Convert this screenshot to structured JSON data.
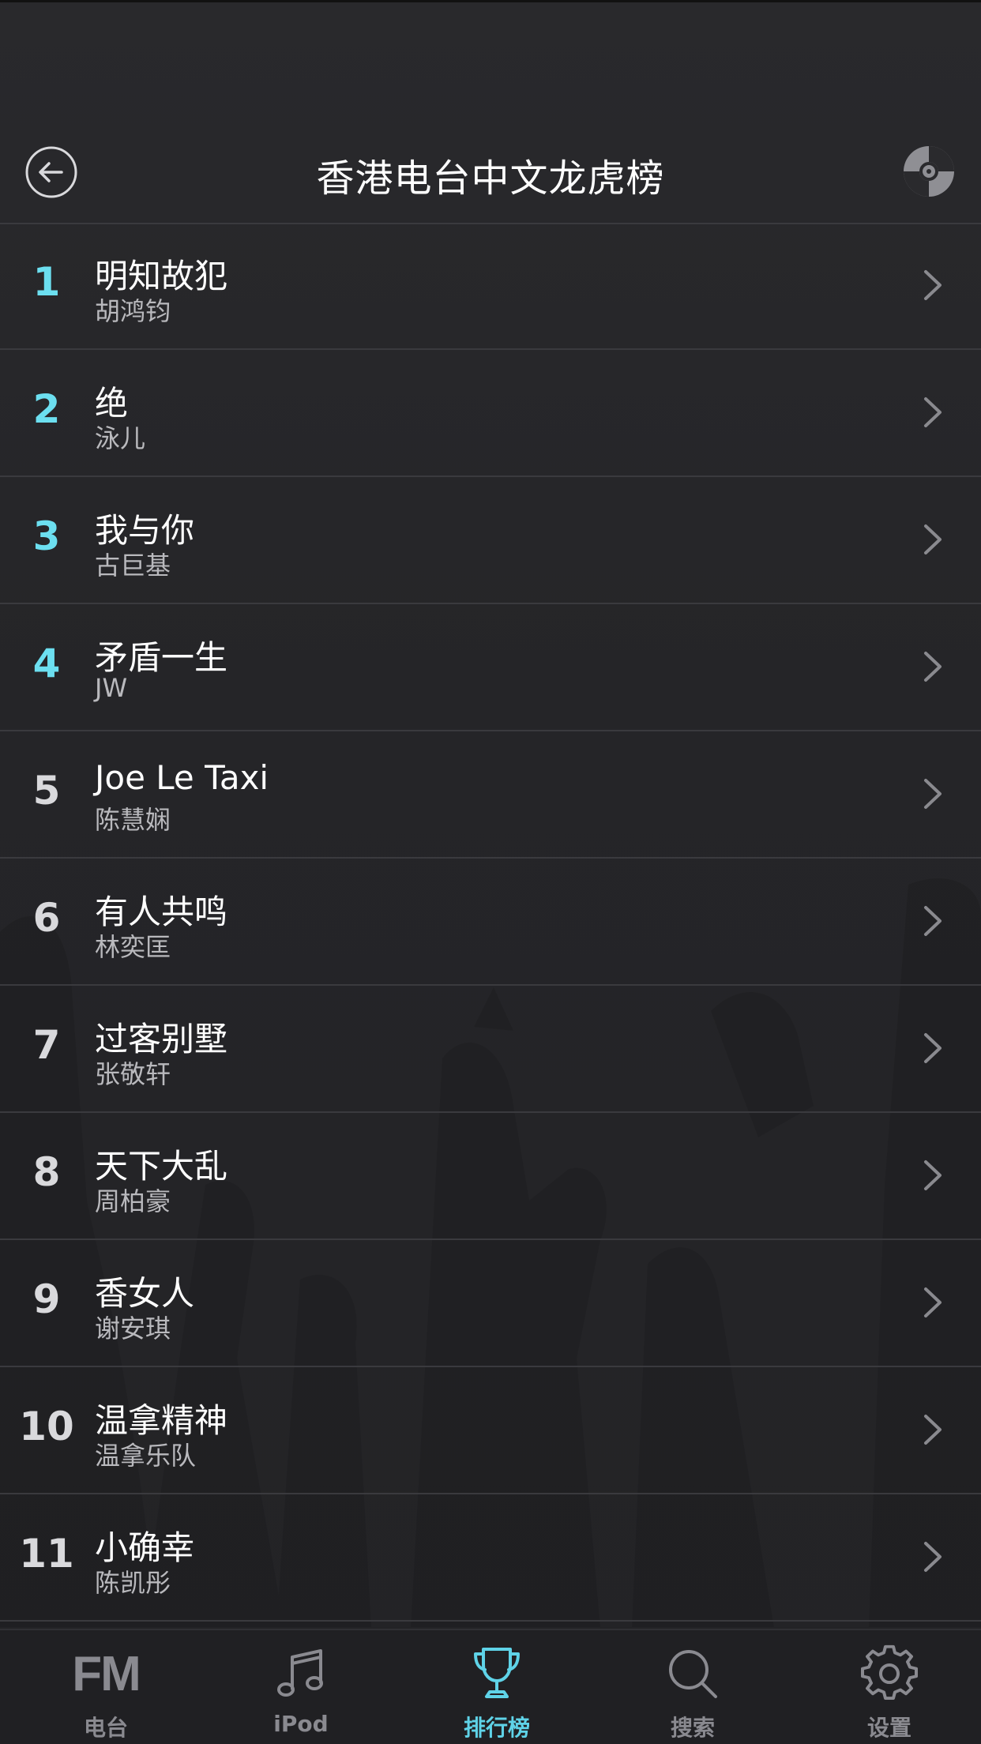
{
  "header": {
    "title": "香港电台中文龙虎榜"
  },
  "colors": {
    "accent": "#5fd3e8",
    "top_rank": "#6cdff0",
    "background": "#242427",
    "divider": "#3a3a3e",
    "inactive": "#8a8a90"
  },
  "chart": [
    {
      "rank": "1",
      "title": "明知故犯",
      "artist": "胡鸿钧",
      "highlight": true
    },
    {
      "rank": "2",
      "title": "绝",
      "artist": "泳儿",
      "highlight": true
    },
    {
      "rank": "3",
      "title": "我与你",
      "artist": "古巨基",
      "highlight": true
    },
    {
      "rank": "4",
      "title": "矛盾一生",
      "artist": "JW",
      "highlight": true
    },
    {
      "rank": "5",
      "title": "Joe Le Taxi",
      "artist": "陈慧娴",
      "highlight": false
    },
    {
      "rank": "6",
      "title": "有人共鸣",
      "artist": "林奕匡",
      "highlight": false
    },
    {
      "rank": "7",
      "title": "过客别墅",
      "artist": "张敬轩",
      "highlight": false
    },
    {
      "rank": "8",
      "title": "天下大乱",
      "artist": "周柏豪",
      "highlight": false
    },
    {
      "rank": "9",
      "title": "香女人",
      "artist": "谢安琪",
      "highlight": false
    },
    {
      "rank": "10",
      "title": "温拿精神",
      "artist": "温拿乐队",
      "highlight": false
    },
    {
      "rank": "11",
      "title": "小确幸",
      "artist": "陈凯彤",
      "highlight": false
    }
  ],
  "tabs": [
    {
      "label": "电台",
      "icon": "fm-icon",
      "icon_text": "FM",
      "active": false
    },
    {
      "label": "iPod",
      "icon": "music-note-icon",
      "active": false
    },
    {
      "label": "排行榜",
      "icon": "trophy-icon",
      "active": true
    },
    {
      "label": "搜索",
      "icon": "search-icon",
      "active": false
    },
    {
      "label": "设置",
      "icon": "gear-icon",
      "active": false
    }
  ]
}
